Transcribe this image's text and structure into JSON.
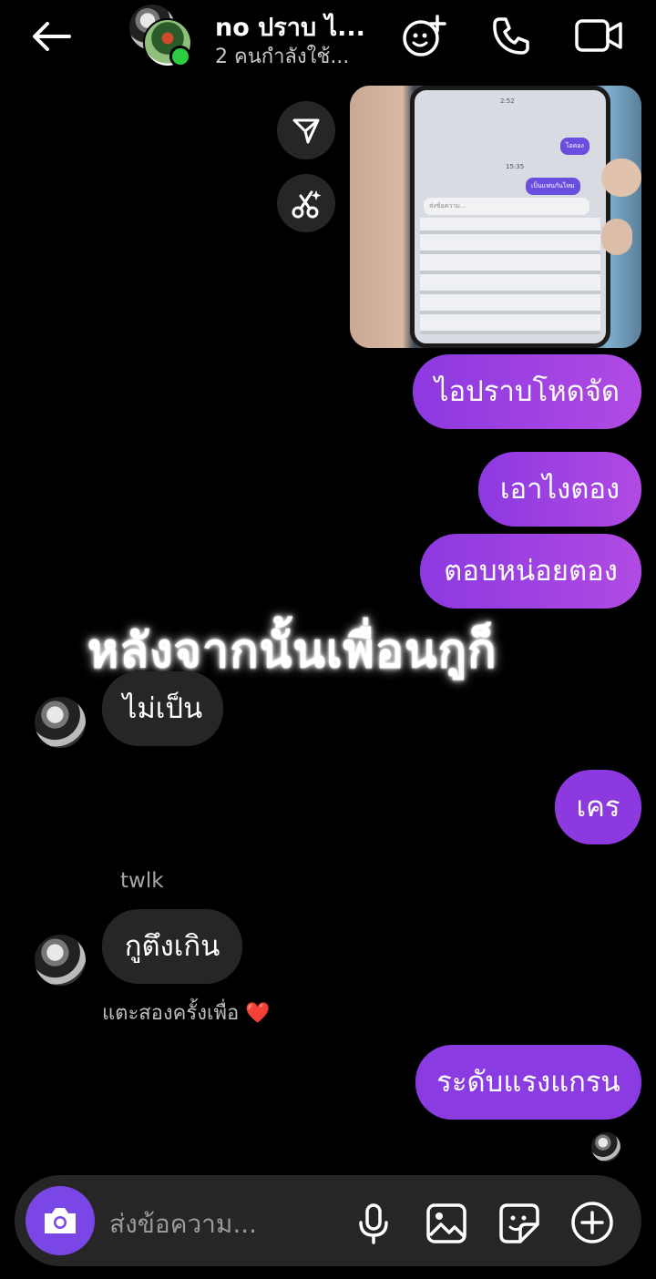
{
  "header": {
    "title": "no ปราบ ไ...",
    "subtitle": "2 คนกำลังใช้...",
    "icons": [
      "back-arrow-icon",
      "add-emoji-icon",
      "phone-icon",
      "video-camera-icon"
    ]
  },
  "side_actions": {
    "icons": [
      "send-icon",
      "ai-cut-icon"
    ]
  },
  "photo_message": {
    "screen_text": {
      "time": "2:52",
      "bubble1": "ไอตอง",
      "time2": "15:35",
      "bubble2": "เป็นแฟนกันไหม",
      "input": "ส่งข้อความ..."
    }
  },
  "messages": [
    {
      "side": "out",
      "text": "ไอปราบโหดจัด"
    },
    {
      "side": "out",
      "text": "เอาไงตอง"
    },
    {
      "side": "out",
      "text": "ตอบหน่อยตอง"
    },
    {
      "side": "in",
      "text": "ไม่เป็น"
    },
    {
      "side": "out",
      "text": "เคร"
    },
    {
      "side": "in",
      "sender": "twlk",
      "text": "กูตึงเกิน",
      "hint": "แตะสองครั้งเพื่อ ❤️"
    },
    {
      "side": "out",
      "text": "ระดับแรงแกรน"
    }
  ],
  "overlay_caption": "หลังจากนั้นเพื่อนกูก็",
  "composer": {
    "placeholder": "ส่งข้อความ...",
    "icons": [
      "camera-icon",
      "microphone-icon",
      "gallery-icon",
      "sticker-icon",
      "plus-icon"
    ]
  },
  "colors": {
    "background": "#000000",
    "outgoing_bubble_start": "#8c39e0",
    "outgoing_bubble_end": "#b14ae3",
    "incoming_bubble": "#262626",
    "camera_button": "#7b46e6",
    "online_dot": "#2ecc40"
  }
}
